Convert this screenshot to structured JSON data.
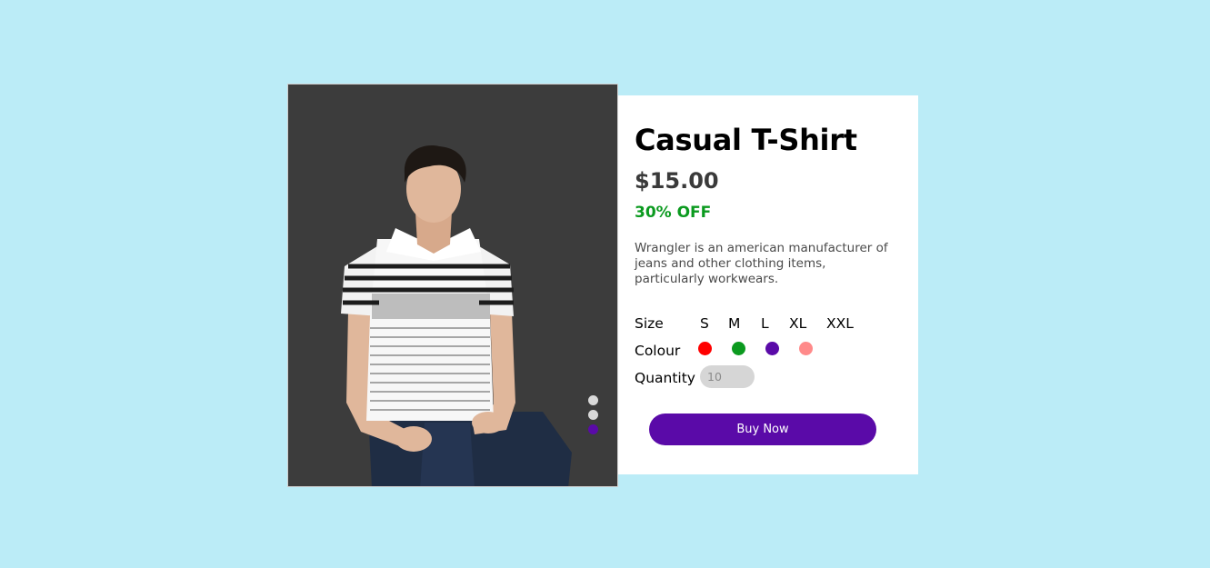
{
  "product": {
    "title": "Casual T-Shirt",
    "price": "$15.00",
    "discount": "30% OFF",
    "description": "Wrangler is an american manufacturer of jeans and other clothing items, particularly workwears."
  },
  "size": {
    "label": "Size",
    "options": [
      "S",
      "M",
      "L",
      "XL",
      "XXL"
    ]
  },
  "colour": {
    "label": "Colour",
    "options": [
      "#ff0000",
      "#0b9a1f",
      "#5a0aa8",
      "#ff8a8a"
    ]
  },
  "quantity": {
    "label": "Quantity",
    "placeholder": "10"
  },
  "buy_button": {
    "label": "Buy Now"
  },
  "carousel": {
    "dot_count": 3,
    "active_index": 2,
    "dot_color": "#d9d9d9",
    "active_color": "#5a0aa8"
  },
  "colors": {
    "background": "#bbecf7",
    "card": "#ffffff",
    "accent": "#5a0aa8",
    "discount": "#0b9a1f",
    "image_background": "#3c3c3c"
  }
}
